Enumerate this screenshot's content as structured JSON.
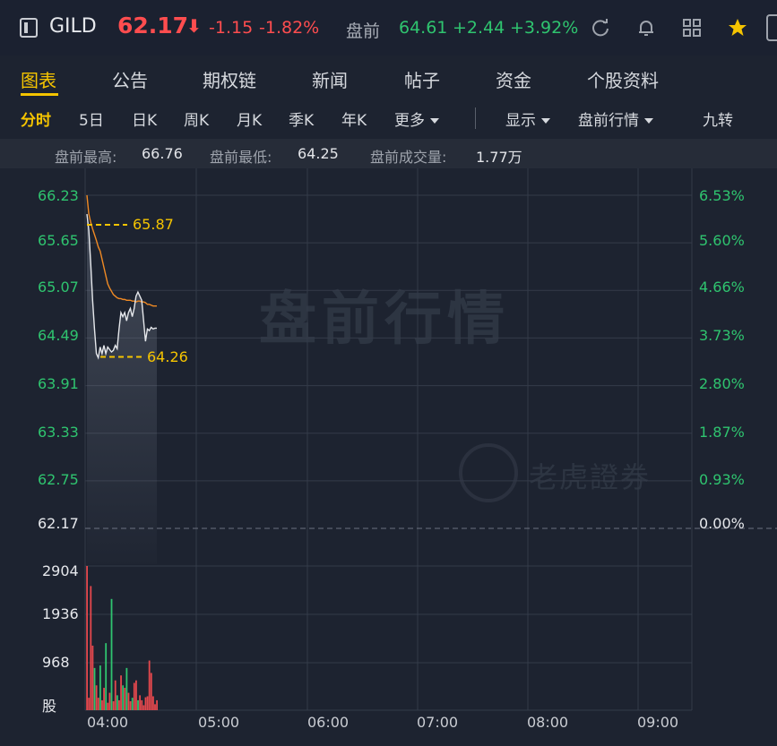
{
  "header": {
    "ticker": "GILD",
    "price": "62.17",
    "arrow": "⬇",
    "change": "-1.15",
    "change_pct": "-1.82%",
    "premarket_label": "盘前",
    "premarket_price": "64.61",
    "premarket_change": "+2.44",
    "premarket_change_pct": "+3.92%",
    "icons": [
      "refresh-icon",
      "bell-icon",
      "grid-icon",
      "star-icon"
    ],
    "colors": {
      "down": "#ff4d4f",
      "up": "#2fc46f",
      "accent": "#f5c400"
    }
  },
  "tabs": [
    "图表",
    "公告",
    "期权链",
    "新闻",
    "帖子",
    "资金",
    "个股资料"
  ],
  "periods": {
    "items": [
      "分时",
      "5日",
      "日K",
      "周K",
      "月K",
      "季K",
      "年K",
      "更多"
    ],
    "display": "显示",
    "premarket_view": "盘前行情",
    "nine_turn": "九转"
  },
  "stats": {
    "high_label": "盘前最高:",
    "high_value": "66.76",
    "low_label": "盘前最低:",
    "low_value": "64.25",
    "volume_label": "盘前成交量:",
    "volume_value": "1.77万"
  },
  "watermark": {
    "main": "盘前行情",
    "brand": "老虎證券"
  },
  "chart_data": {
    "type": "line",
    "y_left_ticks": [
      "66.23",
      "65.65",
      "65.07",
      "64.49",
      "63.91",
      "63.33",
      "62.75",
      "62.17"
    ],
    "y_right_ticks": [
      "6.53%",
      "5.60%",
      "4.66%",
      "3.73%",
      "2.80%",
      "1.87%",
      "0.93%",
      "0.00%"
    ],
    "volume_ticks": [
      "2904",
      "1936",
      "968",
      "股"
    ],
    "x_ticks": [
      "04:00",
      "05:00",
      "06:00",
      "07:00",
      "08:00",
      "09:00"
    ],
    "ylim": [
      62.17,
      66.23
    ],
    "baseline": 62.17,
    "high_marker": "65.87",
    "low_marker": "64.26",
    "series": [
      {
        "kind": "price",
        "x": [
          0,
          1,
          2,
          3,
          4,
          5,
          6,
          7,
          8,
          9,
          10,
          11,
          12,
          13,
          14,
          15,
          16,
          17,
          18,
          19,
          20,
          21,
          22,
          23,
          24,
          25,
          26,
          27,
          28,
          29,
          30,
          31,
          32,
          33,
          34,
          35,
          36,
          37
        ],
        "values": [
          66.0,
          65.8,
          65.4,
          64.95,
          64.6,
          64.3,
          64.25,
          64.38,
          64.3,
          64.4,
          64.3,
          64.38,
          64.35,
          64.32,
          64.34,
          64.4,
          64.36,
          64.6,
          64.8,
          64.75,
          64.8,
          64.7,
          64.8,
          64.85,
          64.75,
          64.85,
          65.0,
          65.05,
          65.0,
          64.95,
          64.7,
          64.45,
          64.6,
          64.58,
          64.62,
          64.6,
          64.61,
          64.61
        ]
      },
      {
        "kind": "average",
        "x": [
          0,
          1,
          2,
          3,
          4,
          5,
          6,
          7,
          8,
          9,
          10,
          11,
          12,
          13,
          14,
          15,
          16,
          17,
          18,
          19,
          20,
          21,
          22,
          23,
          24,
          25,
          26,
          27,
          28,
          29,
          30,
          31,
          32,
          33,
          34,
          35,
          36,
          37
        ],
        "values": [
          66.23,
          66.0,
          65.9,
          65.82,
          65.75,
          65.68,
          65.6,
          65.55,
          65.45,
          65.35,
          65.25,
          65.15,
          65.1,
          65.06,
          65.02,
          65.0,
          64.98,
          64.97,
          64.97,
          64.96,
          64.96,
          64.95,
          64.95,
          64.95,
          64.94,
          64.94,
          64.93,
          64.94,
          64.94,
          64.93,
          64.93,
          64.92,
          64.9,
          64.9,
          64.89,
          64.88,
          64.88,
          64.88
        ]
      }
    ],
    "volume": {
      "x": [
        0,
        1,
        2,
        3,
        4,
        5,
        6,
        7,
        8,
        9,
        10,
        11,
        12,
        13,
        14,
        15,
        16,
        17,
        18,
        19,
        20,
        21,
        22,
        23,
        24,
        25,
        26,
        27,
        28,
        29,
        30,
        31,
        32,
        33,
        34,
        35,
        36,
        37
      ],
      "values": [
        2904,
        250,
        2500,
        1300,
        850,
        500,
        250,
        900,
        200,
        450,
        1350,
        150,
        350,
        2240,
        180,
        600,
        300,
        200,
        700,
        500,
        450,
        850,
        350,
        180,
        250,
        550,
        600,
        200,
        300,
        200,
        100,
        260,
        280,
        1000,
        750,
        280,
        120,
        200
      ],
      "up": [
        false,
        false,
        false,
        false,
        true,
        false,
        false,
        true,
        false,
        false,
        true,
        false,
        false,
        true,
        false,
        false,
        true,
        false,
        false,
        true,
        false,
        true,
        false,
        false,
        true,
        false,
        false,
        true,
        false,
        false,
        false,
        false,
        false,
        false,
        false,
        false,
        false,
        false
      ]
    }
  }
}
